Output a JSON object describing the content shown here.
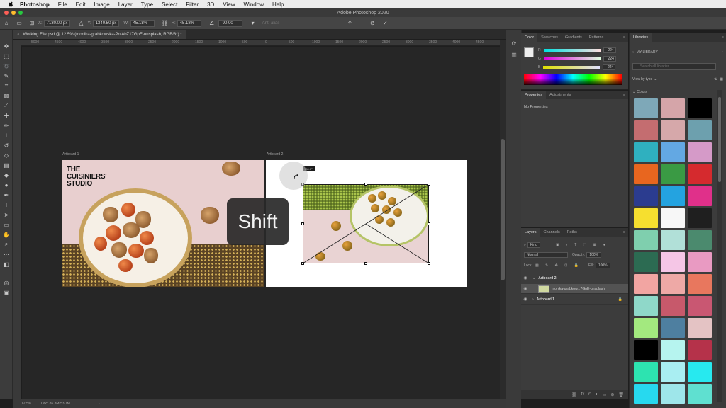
{
  "menubar": {
    "app": "Photoshop",
    "items": [
      "File",
      "Edit",
      "Image",
      "Layer",
      "Type",
      "Select",
      "Filter",
      "3D",
      "View",
      "Window",
      "Help"
    ]
  },
  "titlebar": {
    "title": "Adobe Photoshop 2020"
  },
  "options": {
    "x_label": "X:",
    "x_value": "7130.00 px",
    "y_label": "Y:",
    "y_value": "1340.50 px",
    "w_label": "W:",
    "w_value": "45.18%",
    "h_label": "H:",
    "h_value": "45.18%",
    "angle_value": "-90.00",
    "antialias": "Anti-alias"
  },
  "document": {
    "tab_title": "Working File.psd @ 12.5% (monika-grabkowska-PnlAbZ17GpE-unsplash, RGB/8*) *"
  },
  "ruler": {
    "ticks": [
      "5000",
      "4500",
      "4000",
      "3500",
      "3000",
      "2500",
      "2000",
      "1500",
      "1000",
      "500",
      "0",
      "500",
      "1000",
      "1500",
      "2000",
      "2500",
      "3000",
      "3500",
      "4000",
      "4500"
    ]
  },
  "canvas": {
    "artboard1_label": "Artboard 1",
    "artboard2_label": "Artboard 2",
    "logo_line1": "THE",
    "logo_line2": "CUISINIERS'",
    "logo_line3": "STUDIO",
    "transform_tip": "-90.0°",
    "shift_key": "Shift"
  },
  "status": {
    "zoom": "12.5%",
    "doc": "Doc: 86.3M/53.7M"
  },
  "color_panel": {
    "tabs": [
      "Color",
      "Swatches",
      "Gradients",
      "Patterns"
    ],
    "r_label": "R",
    "g_label": "G",
    "b_label": "B",
    "r_value": "224",
    "g_value": "224",
    "b_value": "224"
  },
  "properties_panel": {
    "tabs": [
      "Properties",
      "Adjustments"
    ],
    "empty_text": "No Properties"
  },
  "layers_panel": {
    "tabs": [
      "Layers",
      "Channels",
      "Paths"
    ],
    "filter": "Kind",
    "blend_mode": "Normal",
    "opacity_label": "Opacity:",
    "opacity_value": "100%",
    "lock_label": "Lock:",
    "fill_label": "Fill:",
    "fill_value": "100%",
    "layers": [
      {
        "name": "Artboard 2"
      },
      {
        "name": "monika-grabkow...7GpE-unsplash"
      },
      {
        "name": "Artboard 1"
      }
    ]
  },
  "libraries": {
    "tab": "Libraries",
    "library_name": "MY LIBRARY",
    "search_placeholder": "Search all libraries",
    "view_by": "View by type",
    "section": "Colors",
    "swatch_colors": [
      "#7ea8b8",
      "#d5a5a9",
      "#000000",
      "#c46d70",
      "#d6a8aa",
      "#6da0ae",
      "#2fb0bf",
      "#63a8e3",
      "#d59ac8",
      "#e8661f",
      "#3a9a44",
      "#d52a2e",
      "#2b3c8f",
      "#24a3e0",
      "#e0308a",
      "#f6df2f",
      "#f7f7f7",
      "#1f1f1f",
      "#7fcfae",
      "#b1e0d8",
      "#4b8a6e",
      "#2c6b52",
      "#f5c6e6",
      "#e99ac2",
      "#f2a5a2",
      "#eea9a6",
      "#e8775e",
      "#8fd8c9",
      "#c7596b",
      "#c95772",
      "#a3e97f",
      "#4e7fa0",
      "#e4c3c4",
      "#000000",
      "#b6f4ef",
      "#b5324a",
      "#2de3b0",
      "#a9eef2",
      "#27e9ef",
      "#27d9ef",
      "#9ee6ea",
      "#5fe0d0"
    ]
  }
}
